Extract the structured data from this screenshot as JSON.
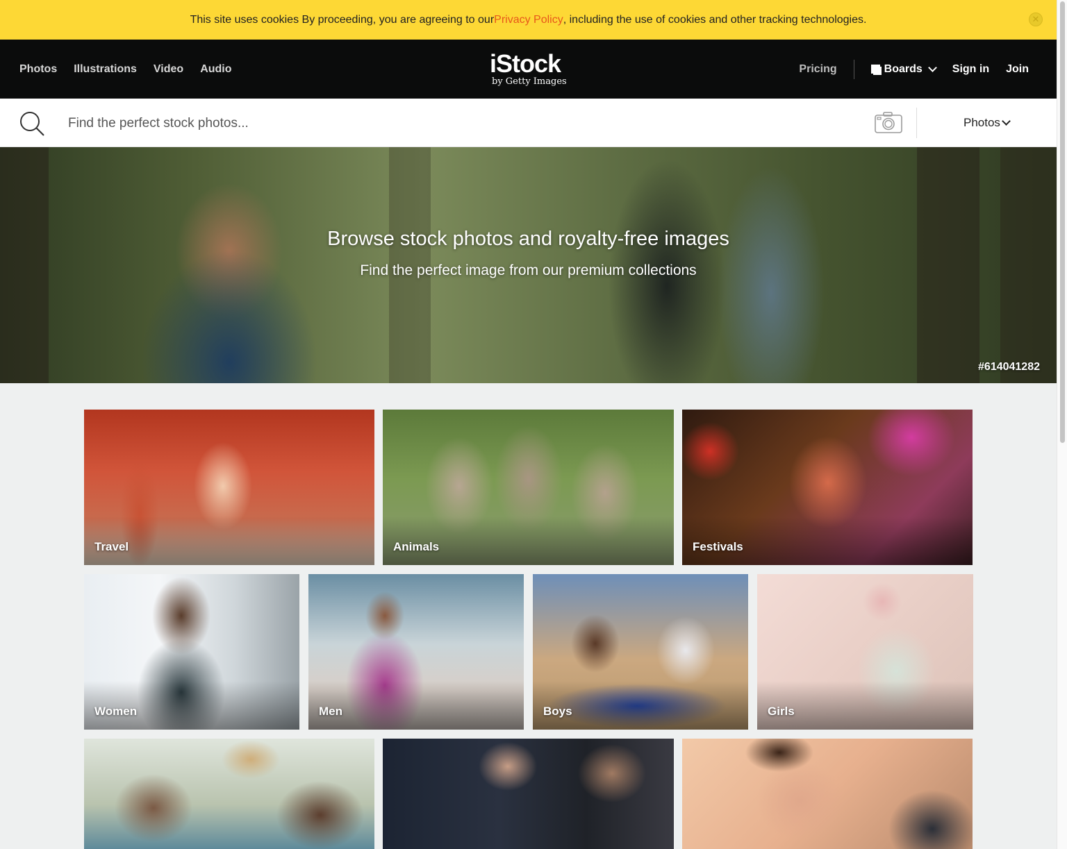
{
  "cookie": {
    "text_before": "This site uses cookies By proceeding, you are agreeing to our ",
    "link": "Privacy Policy",
    "text_after": ", including the use of cookies and other tracking technologies.",
    "close": "✕"
  },
  "header": {
    "nav": [
      "Photos",
      "Illustrations",
      "Video",
      "Audio"
    ],
    "logo_main": "iStock",
    "logo_sub": "by Getty Images",
    "pricing": "Pricing",
    "boards": "Boards",
    "signin": "Sign in",
    "join": "Join"
  },
  "search": {
    "placeholder": "Find the perfect stock photos...",
    "type_selected": "Photos"
  },
  "hero": {
    "title": "Browse stock photos and royalty-free images",
    "subtitle": "Find the perfect image from our premium collections",
    "image_id": "#614041282"
  },
  "tiles": [
    "Travel",
    "Animals",
    "Festivals",
    "Women",
    "Men",
    "Boys",
    "Girls"
  ],
  "colors": {
    "cookie_bg": "#fdd835",
    "accent_link": "#e8571b",
    "header_bg": "#0b0c0c",
    "page_bg": "#eef0f0"
  }
}
